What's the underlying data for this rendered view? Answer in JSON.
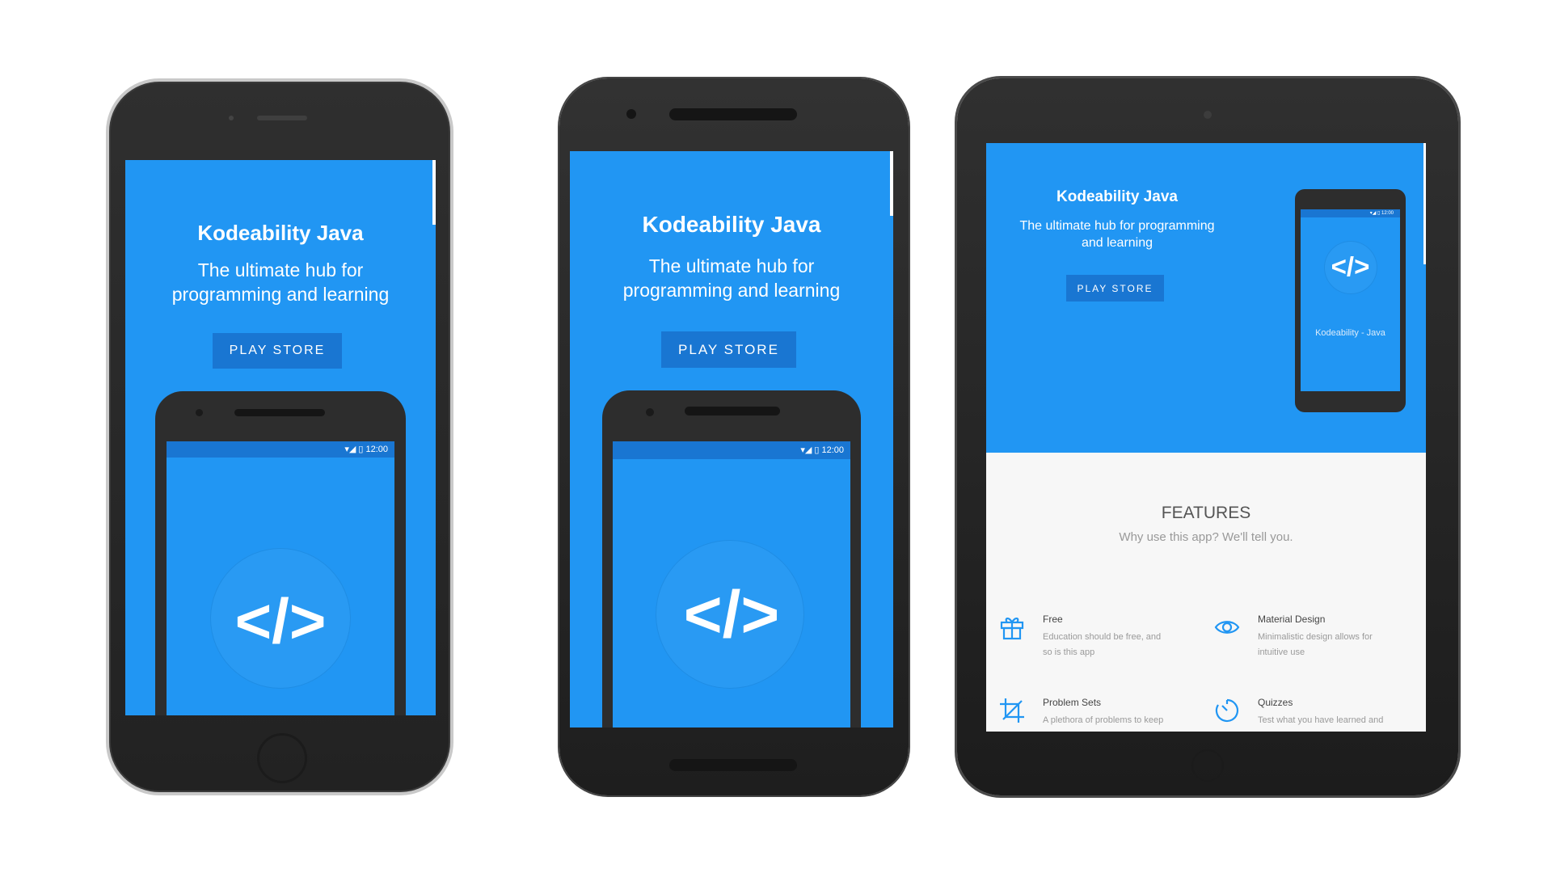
{
  "app": {
    "title": "Kodeability Java",
    "tagline": "The ultimate hub for programming and learning",
    "tagline_line1": "The ultimate hub for",
    "tagline_line2": "programming and learning",
    "tablet_tagline_line1": "The ultimate hub for programming",
    "tablet_tagline_line2": "and learning",
    "play_store_label": "PLAY STORE",
    "code_symbol": "</>",
    "splash_caption": "Kodeability - Java",
    "status_time": "12:00",
    "status_icons": "wifi-signal-battery-icons"
  },
  "features": {
    "title": "FEATURES",
    "subtitle": "Why use this app? We'll tell you.",
    "items": [
      {
        "icon": "gift-icon",
        "title": "Free",
        "desc_line1": "Education should be free, and",
        "desc_line2": "so is this app"
      },
      {
        "icon": "eye-icon",
        "title": "Material Design",
        "desc_line1": "Minimalistic design allows for",
        "desc_line2": "intuitive use"
      },
      {
        "icon": "crop-icon",
        "title": "Problem Sets",
        "desc_line1": "A plethora of problems to keep",
        "desc_line2": ""
      },
      {
        "icon": "timer-icon",
        "title": "Quizzes",
        "desc_line1": "Test what you have learned and",
        "desc_line2": ""
      }
    ]
  },
  "colors": {
    "primary": "#2196f3",
    "primary_dark": "#1976d2",
    "device_body": "#2b2b2b",
    "features_bg": "#f7f7f7"
  }
}
